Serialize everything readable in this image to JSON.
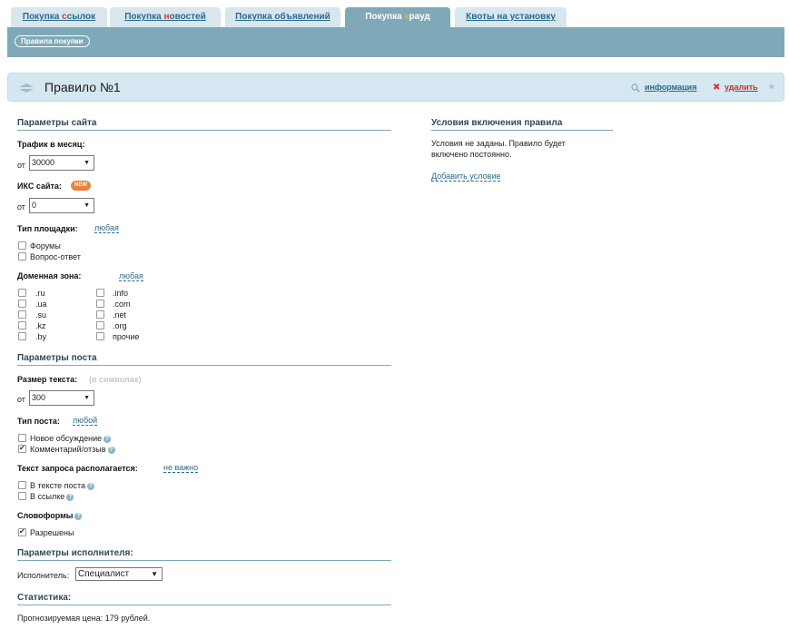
{
  "tabs": [
    {
      "pre": "Покупка ",
      "mark": "с",
      "post": "сылок"
    },
    {
      "pre": "Покупка ",
      "mark": "н",
      "post": "овостей"
    },
    {
      "pre": "Покупка объявлений",
      "mark": "",
      "post": ""
    },
    {
      "pre": "Покупка ",
      "mark": "к",
      "post": "рауд"
    },
    {
      "pre": "Квоты на установку",
      "mark": "",
      "post": ""
    }
  ],
  "subbar": {
    "rules_button": "Правила покупки"
  },
  "rule": {
    "title": "Правило №1",
    "info_link": "информация",
    "delete_link": "удалить"
  },
  "site_params": {
    "title": "Параметры сайта",
    "traffic_label": "Трафик в месяц:",
    "from": "от",
    "traffic_value": "30000",
    "iks_label": "ИКС сайта:",
    "iks_badge": "NEW",
    "iks_value": "0",
    "platform_label": "Тип площадки:",
    "platform_any": "любая",
    "platform_options": [
      "Форумы",
      "Вопрос-ответ"
    ],
    "domain_label": "Доменная зона:",
    "domain_any": "любая",
    "domains_col1": [
      ".ru",
      ".ua",
      ".su",
      ".kz",
      ".by"
    ],
    "domains_col2": [
      ".info",
      ".com",
      ".net",
      ".org",
      "прочие"
    ]
  },
  "post_params": {
    "title": "Параметры поста",
    "text_size_label": "Размер текста:",
    "text_size_hint": "(в символах)",
    "from": "от",
    "text_size_value": "300",
    "post_type_label": "Тип поста:",
    "post_type_any": "любой",
    "post_types": [
      {
        "label": "Новое обсуждение",
        "checked": false
      },
      {
        "label": "Комментарий/отзыв",
        "checked": true
      }
    ],
    "query_label": "Текст запроса располагается:",
    "query_any": "не важно",
    "query_places": [
      "В тексте поста",
      "В ссылке"
    ],
    "wordforms_label": "Словоформы",
    "wordforms_option": "Разрешены"
  },
  "executor": {
    "title": "Параметры исполнителя:",
    "label": "Исполнитель:",
    "value": "Специалист"
  },
  "stats": {
    "title": "Статистика:",
    "price_text": "Прогнозируемая цена: 179 рублей."
  },
  "conditions": {
    "title": "Условия включения правила",
    "text_line1": "Условия не заданы. Правило будет",
    "text_line2": "включено постоянно.",
    "add_link": "Добавить условие"
  },
  "colors": {
    "accent": "#7fa9b8",
    "link": "#2b6a8a",
    "delete": "#c03030",
    "badge": "#e8823c"
  }
}
